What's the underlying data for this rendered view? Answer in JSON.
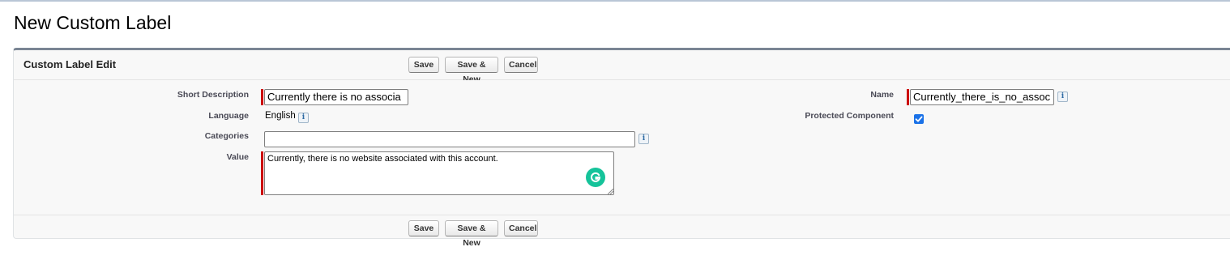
{
  "page": {
    "title": "New Custom Label"
  },
  "panel": {
    "title": "Custom Label Edit"
  },
  "buttons": {
    "save": "Save",
    "save_new": "Save & New",
    "cancel": "Cancel"
  },
  "fields": {
    "short_description": {
      "label": "Short Description",
      "value": "Currently there is no associa"
    },
    "language": {
      "label": "Language",
      "value": "English"
    },
    "categories": {
      "label": "Categories",
      "value": ""
    },
    "value": {
      "label": "Value",
      "value": "Currently, there is no website associated with this account."
    },
    "name": {
      "label": "Name",
      "value": "Currently_there_is_no_assoc"
    },
    "protected_component": {
      "label": "Protected Component",
      "checked": true
    }
  },
  "icons": {
    "info": "i",
    "info_icon_name": "info-icon",
    "grammarly_icon_name": "grammarly-icon"
  },
  "colors": {
    "required_bar": "#cc0000",
    "checkbox": "#1b72e8",
    "grammarly": "#15c39a",
    "panel_border": "#7a8594"
  }
}
